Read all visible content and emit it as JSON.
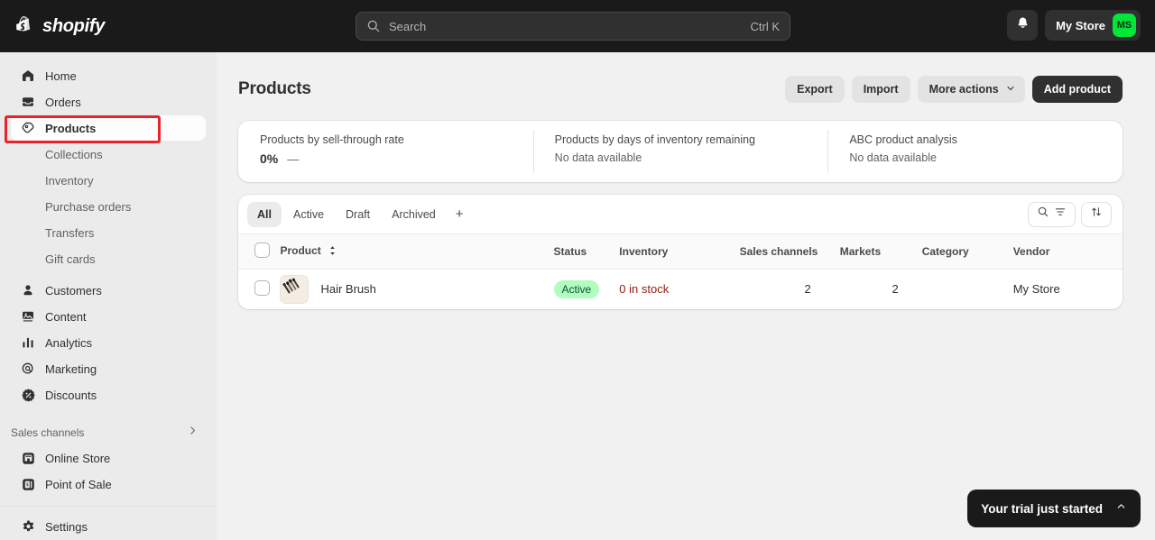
{
  "topbar": {
    "brand_name": "shopify",
    "brand_icon": "shopify-bag-icon",
    "search": {
      "placeholder": "Search",
      "shortcut": "Ctrl K",
      "icon": "search-icon"
    },
    "notifications_icon": "bell-icon",
    "store_name": "My Store",
    "avatar_initials": "MS",
    "avatar_color": "#00e639"
  },
  "sidebar": {
    "items": [
      {
        "label": "Home",
        "icon": "home-icon",
        "active": false
      },
      {
        "label": "Orders",
        "icon": "orders-inbox-icon",
        "active": false
      },
      {
        "label": "Products",
        "icon": "product-tag-icon",
        "active": true
      }
    ],
    "sub_items": [
      {
        "label": "Collections"
      },
      {
        "label": "Inventory"
      },
      {
        "label": "Purchase orders"
      },
      {
        "label": "Transfers"
      },
      {
        "label": "Gift cards"
      }
    ],
    "items_lower": [
      {
        "label": "Customers",
        "icon": "person-icon"
      },
      {
        "label": "Content",
        "icon": "content-image-icon"
      },
      {
        "label": "Analytics",
        "icon": "bar-chart-icon"
      },
      {
        "label": "Marketing",
        "icon": "marketing-target-icon"
      },
      {
        "label": "Discounts",
        "icon": "discount-badge-icon"
      }
    ],
    "section_label": "Sales channels",
    "section_chevron": "chevron-right-icon",
    "channels": [
      {
        "label": "Online Store",
        "icon": "storefront-icon"
      },
      {
        "label": "Point of Sale",
        "icon": "point-of-sale-icon"
      }
    ],
    "settings": {
      "label": "Settings",
      "icon": "gear-icon"
    }
  },
  "page": {
    "title": "Products",
    "actions": {
      "export": "Export",
      "import": "Import",
      "more_actions": "More actions",
      "more_actions_icon": "chevron-down-icon",
      "add_product": "Add product"
    }
  },
  "metrics": [
    {
      "label": "Products by sell-through rate",
      "value": "0%",
      "delta": "—",
      "empty": null
    },
    {
      "label": "Products by days of inventory remaining",
      "value": null,
      "delta": null,
      "empty": "No data available"
    },
    {
      "label": "ABC product analysis",
      "value": null,
      "delta": null,
      "empty": "No data available"
    }
  ],
  "tabs": [
    {
      "label": "All",
      "selected": true
    },
    {
      "label": "Active",
      "selected": false
    },
    {
      "label": "Draft",
      "selected": false
    },
    {
      "label": "Archived",
      "selected": false
    }
  ],
  "tabs_add_label": "+",
  "table_tools": {
    "search_icon": "search-icon",
    "filter_icon": "filter-icon",
    "sort_icon": "sort-arrows-icon"
  },
  "table": {
    "columns": {
      "product": "Product",
      "product_sort_icon": "sort-caret-icon",
      "status": "Status",
      "inventory": "Inventory",
      "sales_channels": "Sales channels",
      "markets": "Markets",
      "category": "Category",
      "vendor": "Vendor"
    },
    "rows": [
      {
        "thumbnail_icon": "hair-brush-photo",
        "product": "Hair Brush",
        "status": "Active",
        "status_color": "#affebf",
        "inventory": "0 in stock",
        "inventory_color": "#8e1f0b",
        "sales_channels": "2",
        "markets": "2",
        "category": "",
        "vendor": "My Store"
      }
    ]
  },
  "toast": {
    "text": "Your trial just started",
    "chevron_icon": "chevron-up-icon"
  },
  "annotations": {
    "color": "#e8232a",
    "targets": [
      "sidebar-item-products",
      "product-table-row"
    ]
  }
}
